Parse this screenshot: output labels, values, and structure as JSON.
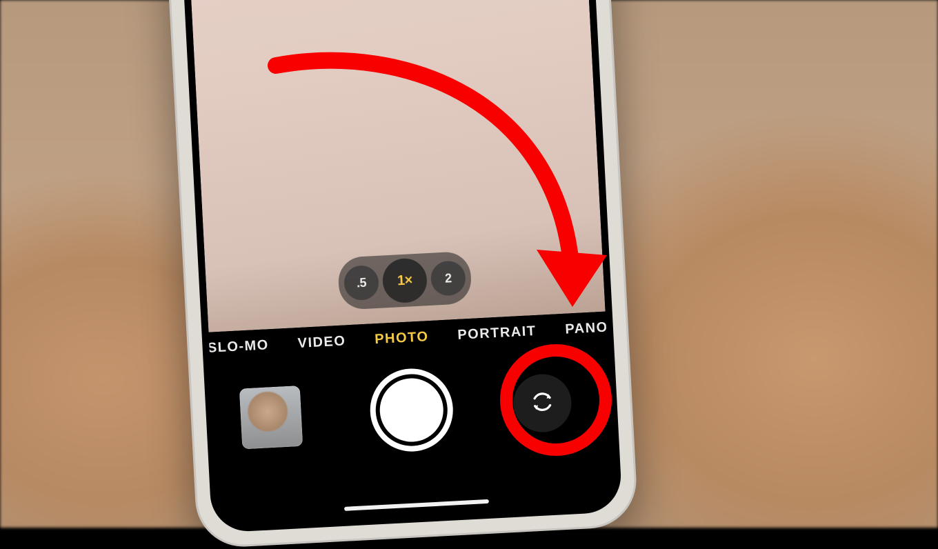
{
  "annotation": {
    "color": "#f80000"
  },
  "camera": {
    "zoom_levels": [
      {
        "label": ".5",
        "selected": false
      },
      {
        "label": "1×",
        "selected": true
      },
      {
        "label": "2",
        "selected": false
      }
    ],
    "modes": [
      {
        "label": "SLO-MO",
        "selected": false
      },
      {
        "label": "VIDEO",
        "selected": false
      },
      {
        "label": "PHOTO",
        "selected": true
      },
      {
        "label": "PORTRAIT",
        "selected": false
      },
      {
        "label": "PANO",
        "selected": false
      }
    ]
  }
}
